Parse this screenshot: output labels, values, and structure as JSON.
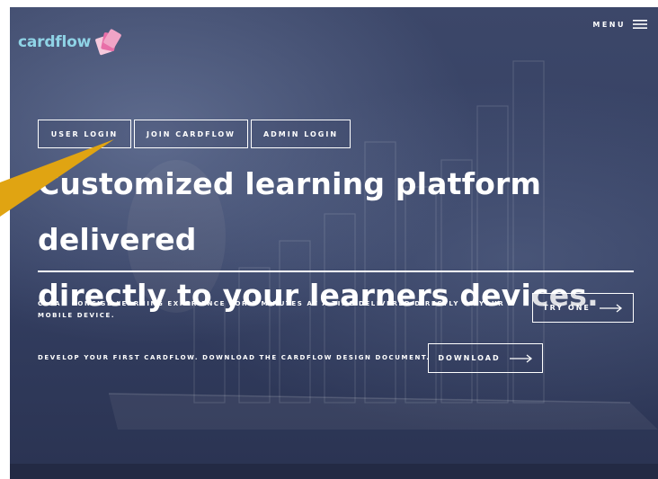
{
  "brand": {
    "logo_text": "cardflow",
    "accent_color": "#8fd3e6",
    "logo_card_colors": [
      "#f0a4c6",
      "#e86fa8",
      "#f6c9dc"
    ]
  },
  "header": {
    "menu_label": "MENU",
    "menu_icon": "hamburger-icon"
  },
  "login_buttons": [
    {
      "label": "USER LOGIN"
    },
    {
      "label": "JOIN CARDFLOW"
    },
    {
      "label": "ADMIN LOGIN"
    }
  ],
  "hero": {
    "headline_line1": "Customized learning platform delivered",
    "headline_line2": "directly to your learners devices."
  },
  "ctas": [
    {
      "text": "CLEAN CONCISE LEARNING EXPERIENCE FOR 2 MINUTES AT A TIME DELIVERED DIRECTLY TO YOUR MOBILE DEVICE.",
      "button_label": "TRY ONE",
      "button_icon": "arrow-right-icon"
    },
    {
      "text": "DEVELOP YOUR FIRST CARDFLOW. DOWNLOAD THE CARDFLOW DESIGN DOCUMENT.",
      "button_label": "DOWNLOAD",
      "button_icon": "arrow-right-icon"
    }
  ],
  "colors": {
    "hero_background": "#3c4769",
    "bottom_band": "#232a44",
    "pointer_annotation": "#e0a412",
    "text": "#ffffff"
  }
}
